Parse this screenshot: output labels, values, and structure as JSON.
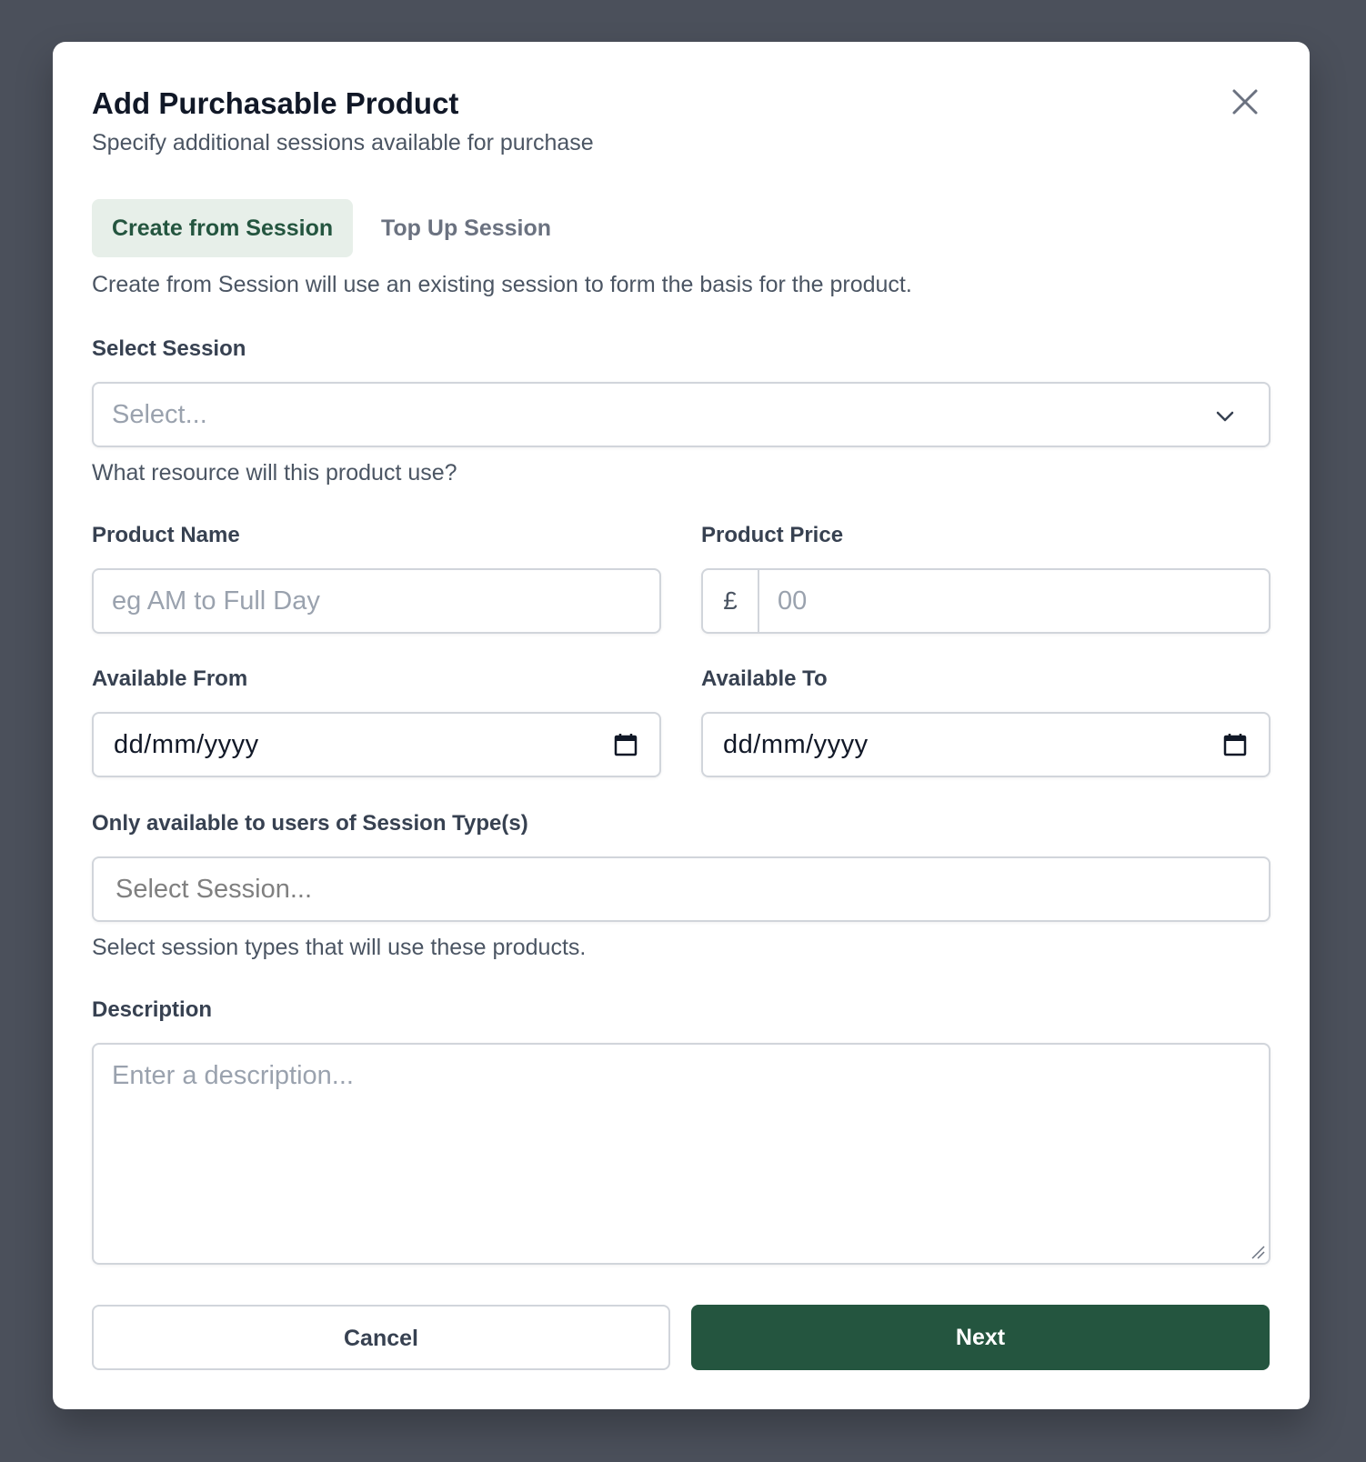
{
  "modal": {
    "title": "Add Purchasable Product",
    "subtitle": "Specify additional sessions available for purchase"
  },
  "tabs": {
    "active": "Create from Session",
    "inactive": "Top Up Session",
    "description": "Create from Session will use an existing session to form the basis for the product."
  },
  "select_session": {
    "label": "Select Session",
    "placeholder": "Select...",
    "help": "What resource will this product use?"
  },
  "product_name": {
    "label": "Product Name",
    "placeholder": "eg AM to Full Day"
  },
  "product_price": {
    "label": "Product Price",
    "currency": "£",
    "placeholder": "00"
  },
  "available_from": {
    "label": "Available From",
    "value": "dd/mm/yyyy"
  },
  "available_to": {
    "label": "Available To",
    "value": "dd/mm/yyyy"
  },
  "session_types": {
    "label": "Only available to users of Session Type(s)",
    "placeholder": "Select Session...",
    "help": "Select session types that will use these products."
  },
  "description": {
    "label": "Description",
    "placeholder": "Enter a description..."
  },
  "buttons": {
    "cancel": "Cancel",
    "next": "Next"
  },
  "colors": {
    "primary": "#24553f",
    "tab_active_bg": "#e7efe9",
    "overlay": "#4b505b"
  },
  "icons": [
    "close-icon",
    "chevron-down-icon",
    "calendar-icon"
  ]
}
